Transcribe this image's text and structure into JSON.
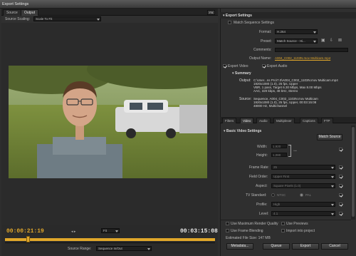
{
  "window": {
    "title": "Export Settings"
  },
  "left_tabs": [
    {
      "label": "Source",
      "active": false
    },
    {
      "label": "Output",
      "active": true
    }
  ],
  "fit_button": "Fit",
  "source_scaling": {
    "label": "Source Scaling:",
    "value": "Scale To Fit"
  },
  "timeline": {
    "current_time": "00:00:21:19",
    "end_time": "00:03:15:08",
    "zoom": "Fit",
    "source_range_label": "Source Range:",
    "source_range_value": "Sequence In/Out",
    "playhead_fraction": 0.11
  },
  "export_settings": {
    "header": "Export Settings",
    "match_sequence_label": "Match Sequence Settings",
    "match_sequence_checked": false,
    "format_label": "Format:",
    "format_value": "H.264",
    "preset_label": "Preset:",
    "preset_value": "Match Source - Hi...",
    "comments_label": "Comments:",
    "comments_value": "",
    "output_name_label": "Output Name:",
    "output_name_value": "A004_C002_1103N.mov Multicam.mp4",
    "export_video_label": "Export Video",
    "export_video_checked": true,
    "export_audio_label": "Export Audio",
    "export_audio_checked": true
  },
  "summary": {
    "header": "Summary",
    "output_label": "Output:",
    "output_lines": [
      "C:\\User...ns Pro\\7.0\\A004_C002_1103N.mov Multicam.mp4",
      "1920x1080 (1.0), 25 fps, Upper",
      "VBR, 1 pass, Target 6.30 Mbps, Max 8.00 Mbps",
      "AAC, 320 kbps, 48 kHz, Stereo"
    ],
    "source_label": "Source:",
    "source_lines": [
      "Sequence, A004_C002_1103N.mov Multicam",
      "1920x1080 (1.0), 25 fps, Upper, 00:03:15:08",
      "48000 Hz, Multichannel"
    ]
  },
  "panel_tabs": [
    {
      "label": "Filters",
      "active": false
    },
    {
      "label": "Video",
      "active": true
    },
    {
      "label": "Audio",
      "active": false
    },
    {
      "label": "Multiplexer",
      "active": false
    },
    {
      "label": "Captions",
      "active": false
    },
    {
      "label": "FTP",
      "active": false
    }
  ],
  "basic_video": {
    "header": "Basic Video Settings",
    "match_source_button": "Match Source",
    "width_label": "Width:",
    "width_value": "1,920",
    "height_label": "Height:",
    "height_value": "1,080",
    "rows": [
      {
        "label": "Frame Rate:",
        "value": "25"
      },
      {
        "label": "Field Order:",
        "value": "Upper First"
      },
      {
        "label": "Aspect:",
        "value": "Square Pixels (1.0)"
      },
      {
        "label": "TV Standard:",
        "value": "NTSC",
        "value2": "PAL"
      },
      {
        "label": "Profile:",
        "value": "High"
      },
      {
        "label": "Level:",
        "value": "4.1"
      }
    ]
  },
  "bottom_options": {
    "max_render_quality": "Use Maximum Render Quality",
    "use_previews": "Use Previews",
    "use_frame_blending": "Use Frame Blending",
    "import_into_project": "Import into project",
    "file_size": "Estimated File Size: 147 MB"
  },
  "buttons": {
    "metadata": "Metadata...",
    "queue": "Queue",
    "export": "Export",
    "cancel": "Cancel"
  },
  "colors": {
    "accent_orange": "#e1a72a",
    "panel_bg": "#2f2f2f",
    "link_orange": "#d69a2b"
  }
}
